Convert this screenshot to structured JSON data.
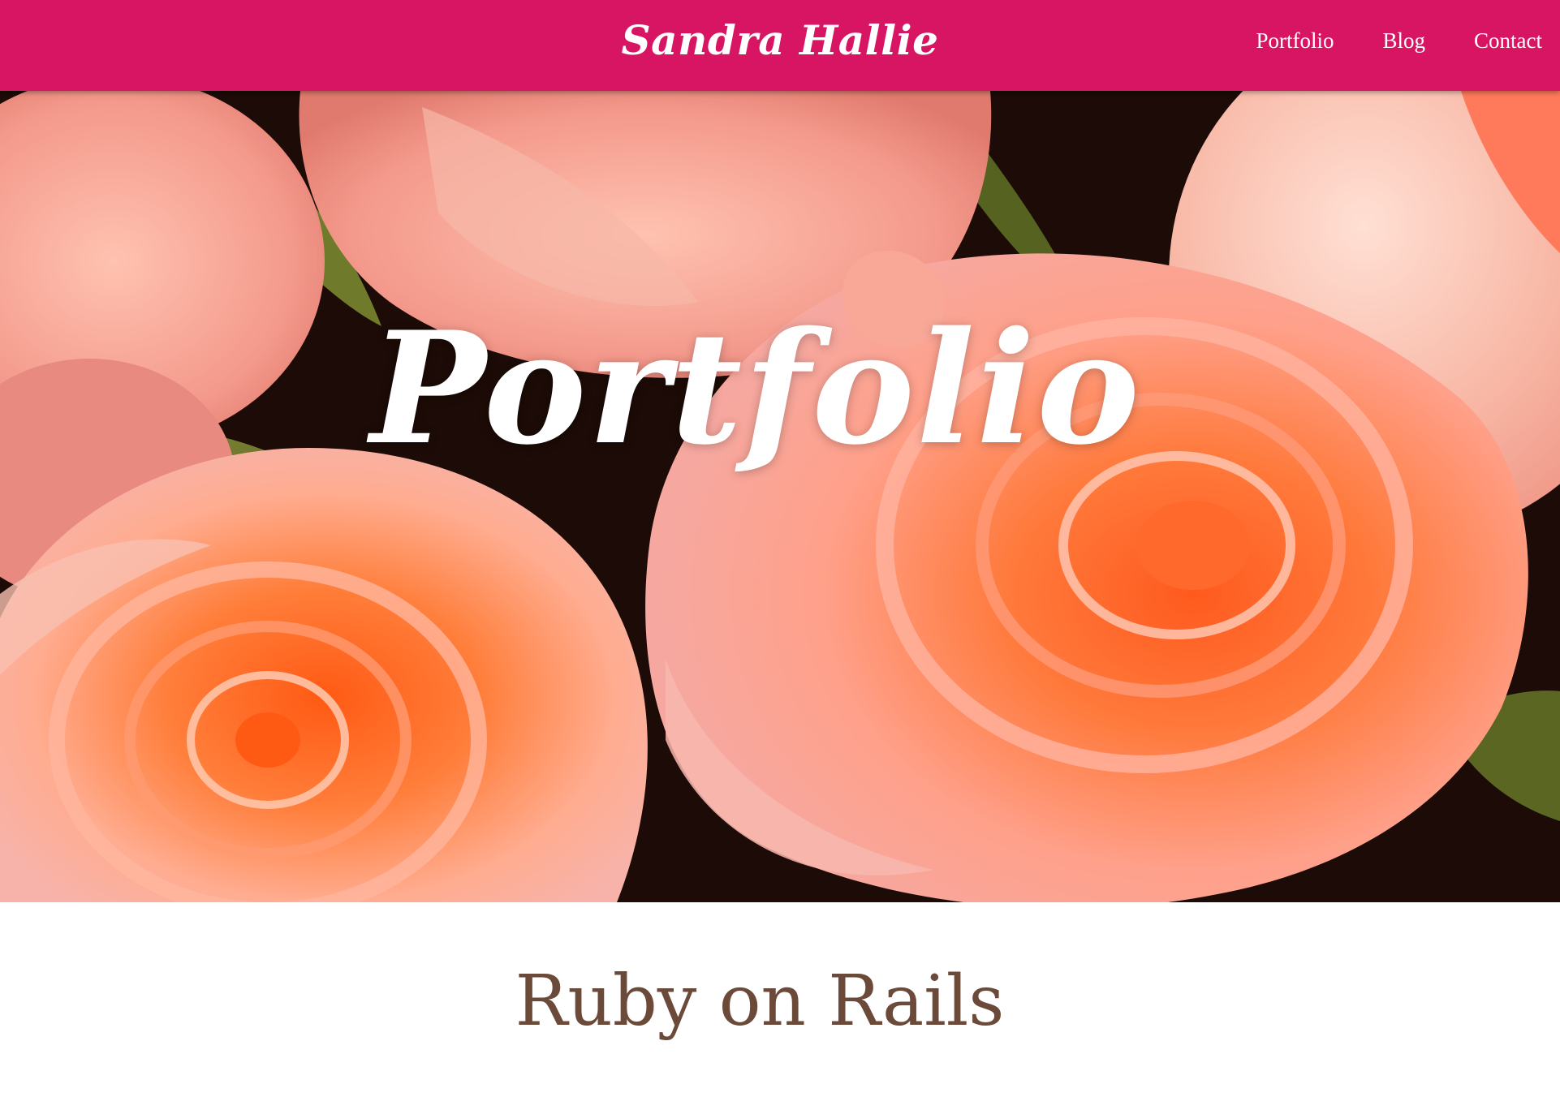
{
  "header": {
    "brand": "Sandra Hallie",
    "nav": [
      {
        "label": "Portfolio"
      },
      {
        "label": "Blog"
      },
      {
        "label": "Contact"
      }
    ],
    "background_color": "#d81562"
  },
  "hero": {
    "title": "Portfolio",
    "image": "rose-bouquet-photo"
  },
  "section": {
    "heading": "Ruby on Rails",
    "heading_color": "#6b4a3a"
  }
}
